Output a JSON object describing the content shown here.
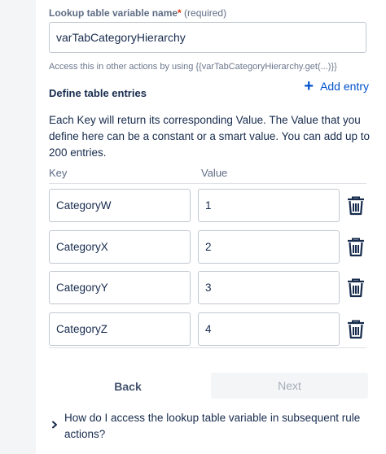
{
  "variable_name": {
    "label": "Lookup table variable name",
    "required_star": "*",
    "required_text": " (required)",
    "value": "varTabCategoryHierarchy",
    "helper": "Access this in other actions by using {{varTabCategoryHierarchy.get(...)}}"
  },
  "entries": {
    "title": "Define table entries",
    "add_label": "Add entry",
    "description": "Each Key will return its corresponding Value. The Value that you define here can be a constant or a smart value. You can add up to 200 entries.",
    "key_header": "Key",
    "value_header": "Value",
    "rows": [
      {
        "key": "CategoryW",
        "value": "1"
      },
      {
        "key": "CategoryX",
        "value": "2"
      },
      {
        "key": "CategoryY",
        "value": "3"
      },
      {
        "key": "CategoryZ",
        "value": "4"
      }
    ]
  },
  "footer": {
    "back_label": "Back",
    "next_label": "Next"
  },
  "faq": {
    "question": "How do I access the lookup table variable in subsequent rule actions?"
  },
  "colors": {
    "link": "#0052cc",
    "required": "#de350b",
    "border": "#c1c7d0",
    "disabled_text": "#a5adba"
  },
  "icons": {
    "add": "plus-icon",
    "delete": "trash-icon",
    "expand": "chevron-right-icon"
  }
}
